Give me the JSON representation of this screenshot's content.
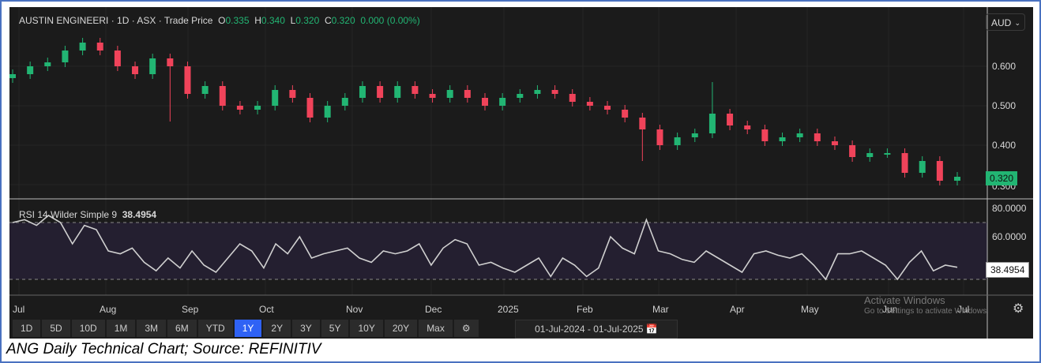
{
  "header": {
    "symbol": "AUSTIN ENGINEERI",
    "interval": "1D",
    "exchange": "ASX",
    "price_type": "Trade Price",
    "open_label": "O",
    "open": "0.335",
    "high_label": "H",
    "high": "0.340",
    "low_label": "L",
    "low": "0.320",
    "close_label": "C",
    "close": "0.320",
    "change": "0.000 (0.00%)",
    "sep": "·"
  },
  "currency": "AUD",
  "price_axis": [
    "0.600",
    "0.500",
    "0.400",
    "0.300"
  ],
  "last_price_tag": "0.320",
  "rsi": {
    "title": "RSI 14 Wilder Simple 9",
    "value": "38.4954",
    "axis": [
      "80.0000",
      "60.0000"
    ]
  },
  "x_axis": [
    "Jul",
    "Aug",
    "Sep",
    "Oct",
    "Nov",
    "Dec",
    "2025",
    "Feb",
    "Mar",
    "Apr",
    "May",
    "Jun",
    "Jul"
  ],
  "ranges": [
    "1D",
    "5D",
    "10D",
    "1M",
    "3M",
    "6M",
    "YTD",
    "1Y",
    "2Y",
    "3Y",
    "5Y",
    "10Y",
    "20Y",
    "Max"
  ],
  "active_range": "1Y",
  "date_from": "01-Jul-2024",
  "date_to": "01-Jul-2025",
  "date_sep": "-",
  "watermark": {
    "title": "Activate Windows",
    "sub": "Go to Settings to activate Windows."
  },
  "caption": "ANG Daily Technical Chart; Source: REFINITIV",
  "colors": {
    "up": "#22b573",
    "down": "#f0435a",
    "rsi": "#d0d0d0"
  },
  "chart_data": {
    "type": "candlestick",
    "price_range": [
      0.3,
      0.66
    ],
    "closes": [
      0.58,
      0.6,
      0.61,
      0.64,
      0.66,
      0.64,
      0.6,
      0.58,
      0.62,
      0.6,
      0.53,
      0.55,
      0.5,
      0.49,
      0.5,
      0.54,
      0.52,
      0.47,
      0.5,
      0.52,
      0.55,
      0.52,
      0.55,
      0.53,
      0.52,
      0.54,
      0.52,
      0.5,
      0.52,
      0.53,
      0.54,
      0.53,
      0.51,
      0.5,
      0.49,
      0.47,
      0.44,
      0.4,
      0.42,
      0.43,
      0.48,
      0.45,
      0.44,
      0.41,
      0.42,
      0.43,
      0.41,
      0.4,
      0.37,
      0.38,
      0.38,
      0.33,
      0.36,
      0.31,
      0.32
    ],
    "rsi_range": [
      20,
      85
    ],
    "rsi_bands": [
      30,
      70
    ],
    "rsi_values": [
      70,
      72,
      68,
      75,
      70,
      55,
      68,
      65,
      50,
      48,
      52,
      42,
      36,
      45,
      38,
      50,
      40,
      35,
      45,
      55,
      50,
      38,
      55,
      48,
      60,
      45,
      48,
      50,
      52,
      45,
      42,
      50,
      48,
      50,
      55,
      40,
      52,
      58,
      55,
      40,
      42,
      38,
      35,
      40,
      45,
      32,
      45,
      40,
      32,
      38,
      60,
      52,
      48,
      72,
      50,
      48,
      44,
      42,
      50,
      45,
      40,
      35,
      48,
      50,
      47,
      45,
      48,
      40,
      30,
      48,
      48,
      50,
      45,
      40,
      30,
      42,
      50,
      36,
      40,
      38.5
    ]
  }
}
